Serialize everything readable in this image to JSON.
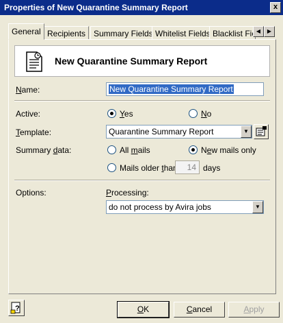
{
  "window": {
    "title": "Properties of New Quarantine Summary Report",
    "close_label": "x"
  },
  "tabs": [
    {
      "label": "General"
    },
    {
      "label": "Recipients"
    },
    {
      "label": "Summary Fields"
    },
    {
      "label": "Whitelist Fields"
    },
    {
      "label": "Blacklist Field"
    }
  ],
  "header": {
    "title": "New Quarantine Summary Report"
  },
  "form": {
    "name_label": "Name:",
    "name_value": "New Quarantine Summary Report",
    "active_label": "Active:",
    "active_yes": "Yes",
    "active_no": "No",
    "active_selected": "Yes",
    "template_label": "Template:",
    "template_value": "Quarantine Summary Report",
    "summary_label": "Summary data:",
    "summary_all": "All mails",
    "summary_new": "New mails only",
    "summary_older_prefix": "Mails older than",
    "summary_older_days": "14",
    "summary_older_suffix": "days",
    "summary_selected": "New mails only",
    "options_label": "Options:",
    "processing_label": "Processing:",
    "processing_value": "do not process by Avira jobs"
  },
  "buttons": {
    "ok": "OK",
    "cancel": "Cancel",
    "apply": "Apply"
  },
  "icons": {
    "help": "help-icon",
    "doc": "document-icon",
    "template_edit": "template-properties-icon",
    "tab_left": "arrow-left-icon",
    "tab_right": "arrow-right-icon"
  }
}
